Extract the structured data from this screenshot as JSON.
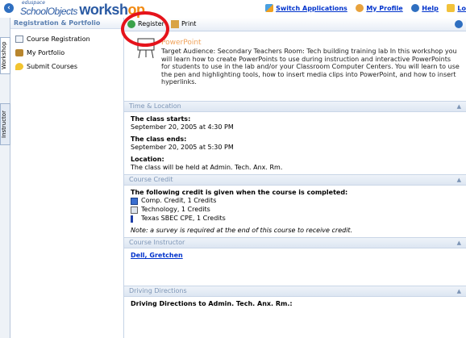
{
  "header": {
    "logo_school": "SchoolObjects",
    "logo_product": "workshop",
    "logo_prefix": "eduspace",
    "links": [
      {
        "label": "Switch Applications",
        "icon": "switch-applications-icon"
      },
      {
        "label": "My Profile",
        "icon": "profile-icon"
      },
      {
        "label": "Help",
        "icon": "help-icon"
      },
      {
        "label": "Lo",
        "icon": "logout-icon"
      }
    ]
  },
  "tabs": {
    "workshop": "Workshop",
    "instructor": "Instructor"
  },
  "sidebar": {
    "title": "Registration & Portfolio",
    "items": [
      {
        "label": "Course Registration",
        "icon": "course-registration-icon"
      },
      {
        "label": "My Portfolio",
        "icon": "portfolio-icon"
      },
      {
        "label": "Submit Courses",
        "icon": "submit-courses-icon"
      }
    ]
  },
  "toolbar": {
    "register_label": "Register",
    "print_label": "Print"
  },
  "course": {
    "title": "PowerPoint",
    "description": "Target Audience: Secondary Teachers Room: Tech building training lab In this workshop you will learn how to create PowerPoints to use during instruction and interactive PowerPoints for students to use in the lab and/or your Classroom Computer Centers. You will learn to use the pen and highlighting tools, how to insert media clips into PowerPoint, and how to insert hyperlinks."
  },
  "time_location": {
    "heading": "Time & Location",
    "starts_label": "The class starts:",
    "starts_value": "September 20, 2005 at 4:30 PM",
    "ends_label": "The class ends:",
    "ends_value": "September 20, 2005 at 5:30 PM",
    "location_label": "Location:",
    "location_value": "The class will be held at Admin. Tech. Anx. Rm."
  },
  "course_credit": {
    "heading": "Course Credit",
    "intro": "The following credit is given when the course is completed:",
    "credits": [
      {
        "label": "Comp. Credit, 1 Credits",
        "icon": "comp-credit-icon"
      },
      {
        "label": "Technology, 1 Credits",
        "icon": "technology-icon"
      },
      {
        "label": "Texas SBEC CPE, 1 Credits",
        "icon": "texas-flag-icon"
      }
    ],
    "note": "Note: a survey is required at the end of this course to receive credit."
  },
  "instructor": {
    "heading": "Course Instructor",
    "name": "Dell, Gretchen"
  },
  "directions": {
    "heading": "Driving Directions",
    "text": "Driving Directions to Admin. Tech. Anx. Rm.:"
  },
  "colors": {
    "accent": "#2a5aa3",
    "highlight_circle": "#e5131b",
    "section_text": "#7d95b6",
    "course_title": "#f0a25a"
  }
}
